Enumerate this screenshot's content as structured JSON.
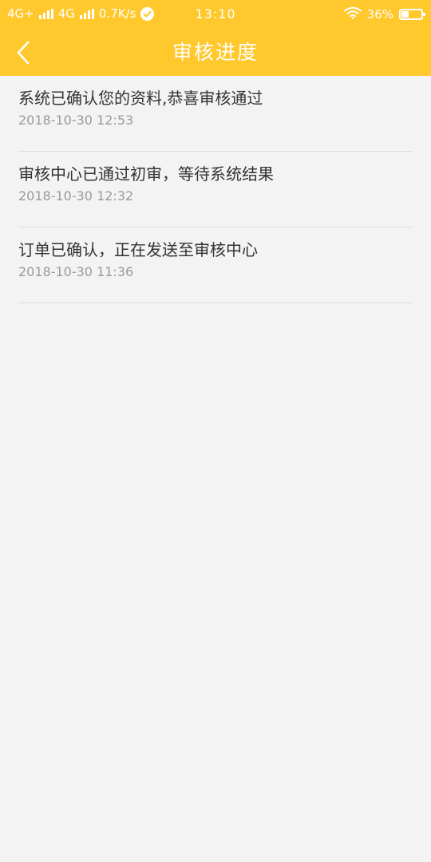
{
  "status_bar": {
    "network_1": "4G+",
    "network_2": "4G",
    "speed": "0.7K/s",
    "time": "13:10",
    "battery": "36%"
  },
  "header": {
    "title": "审核进度",
    "back_icon": "chevron-left-icon"
  },
  "progress": [
    {
      "message": "系统已确认您的资料,恭喜审核通过",
      "time": "2018-10-30 12:53"
    },
    {
      "message": "审核中心已通过初审，等待系统结果",
      "time": "2018-10-30 12:32"
    },
    {
      "message": "订单已确认，正在发送至审核中心",
      "time": "2018-10-30 11:36"
    }
  ],
  "colors": {
    "header_bg": "#ffc82c",
    "page_bg": "#f3f3f3",
    "text": "#333333",
    "subtext": "#9a9a9a"
  }
}
